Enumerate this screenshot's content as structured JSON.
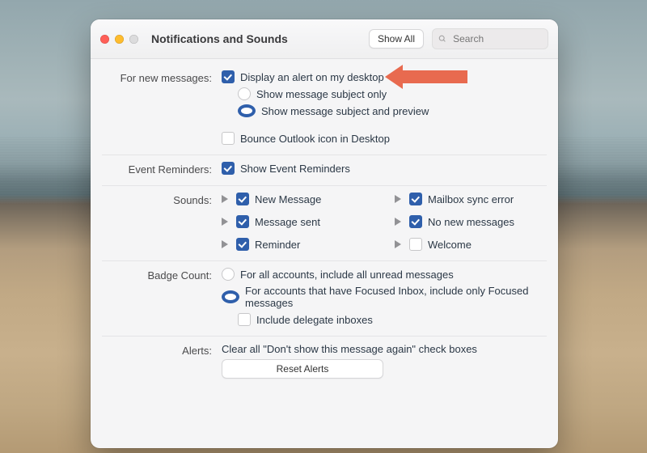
{
  "window": {
    "title": "Notifications and Sounds",
    "show_all": "Show All",
    "search_placeholder": "Search"
  },
  "for_new_messages": {
    "label": "For new messages:",
    "display_alert": "Display an alert on my desktop",
    "subject_only": "Show message subject only",
    "subject_preview": "Show message subject and preview",
    "bounce_icon": "Bounce Outlook icon in Desktop"
  },
  "event_reminders": {
    "label": "Event Reminders:",
    "show": "Show Event Reminders"
  },
  "sounds": {
    "label": "Sounds:",
    "new_message": "New Message",
    "mailbox_sync_error": "Mailbox sync error",
    "message_sent": "Message sent",
    "no_new_messages": "No new messages",
    "reminder": "Reminder",
    "welcome": "Welcome"
  },
  "badge_count": {
    "label": "Badge Count:",
    "all_accounts": "For all accounts, include all unread messages",
    "focused": "For accounts that have Focused Inbox, include only Focused messages",
    "include_delegate": "Include delegate inboxes"
  },
  "alerts": {
    "label": "Alerts:",
    "clear_text": "Clear all \"Don't show this message again\" check boxes",
    "reset_button": "Reset Alerts"
  }
}
